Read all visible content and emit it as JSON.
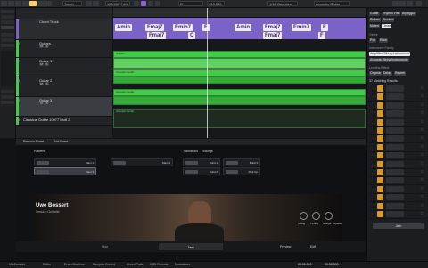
{
  "toolbar": {
    "transport_mode": "Touch",
    "tempo": "120.000",
    "time_sig": "4/4",
    "key": "C",
    "quantize": "1/16 Quantize",
    "track_name": "Acoustic Guitar",
    "accent_color": "#ffd24a"
  },
  "chord_track": {
    "name": "Chord Track",
    "color": "#7a62c7",
    "chords": [
      "Amin",
      "Fmaj7",
      "Fmaj7",
      "Emin7",
      "F",
      "Amin",
      "Fmaj7",
      "Emin7",
      "F",
      "Fmaj7",
      "C",
      "F"
    ]
  },
  "tracks": [
    {
      "num": "1",
      "name": "Guitars",
      "color": "#45c94a"
    },
    {
      "num": "2",
      "name": "Guitar 1",
      "color": "#45c94a"
    },
    {
      "num": "3",
      "name": "Guitar 2",
      "color": "#45c94a"
    },
    {
      "num": "4",
      "name": "Guitar 3",
      "color": "#45c94a"
    },
    {
      "num": "5",
      "name": "Classical Guitar 10077 Mutt 2",
      "color": "#45c94a"
    }
  ],
  "clips": {
    "label_folder": "Guitars",
    "label_guitar": "Acoustic Guitar",
    "color": "#45c94a"
  },
  "editor": {
    "tabs": [
      "Remove Event",
      "Add Event"
    ],
    "patterns_label": "Patterns",
    "transitions_label": "Transitions",
    "endings_label": "Endings",
    "patterns": [
      {
        "label": "Main 1"
      },
      {
        "label": "Main 2"
      },
      {
        "label": "Main 3"
      },
      {
        "label": "Build 1"
      },
      {
        "label": "Build 2"
      },
      {
        "label": "Build 3"
      },
      {
        "label": "Pick Up"
      }
    ],
    "player_name": "Uwe Bossert",
    "player_role": "Session Guitarist",
    "knob_labels": [
      "Swing",
      "Timing",
      "Strings",
      "Speed"
    ],
    "footer_label": "Jam",
    "footer_left": "Hide",
    "footer_right": "Preview",
    "footer_edit": "Edit"
  },
  "right_panel": {
    "chips_row1": [
      "Guitar",
      "Rhythm Part",
      "Arpeggio",
      "Picked",
      "Plucked",
      "Muted",
      "Clean"
    ],
    "genre_label": "Genre",
    "genre_chips": [
      "Pop",
      "Rock"
    ],
    "family_label": "Instrument Family",
    "family_chips": [
      "Amplified String Instruments",
      "Acoustic String Instruments"
    ],
    "mood_label": "Leading Effect",
    "mood_chips": [
      "Organic",
      "Delay",
      "Reverb"
    ],
    "results_label": "37 Matching Results",
    "results_count": 16,
    "bottom_button": "Jam"
  },
  "status_tabs": [
    "MixConsole",
    "Editor",
    "Drum Machine",
    "Sampler Control",
    "Chord Pads",
    "MIDI Remote",
    "Modulators"
  ],
  "status_time": "00:06.000",
  "status_time2": "00:06.000"
}
